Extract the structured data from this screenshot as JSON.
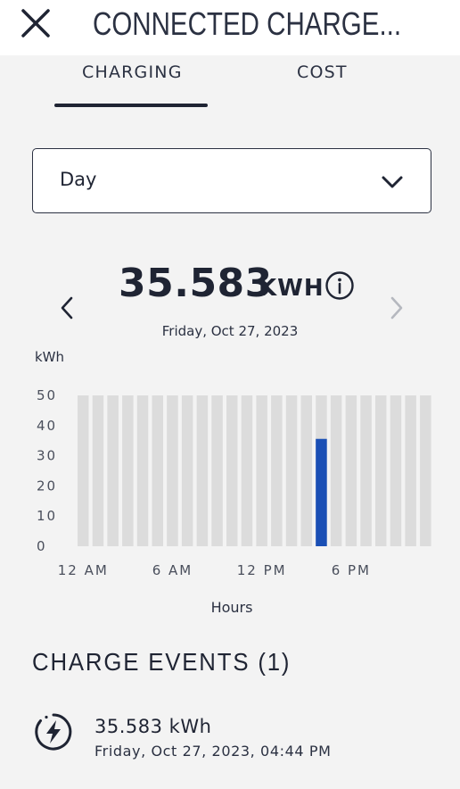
{
  "header": {
    "title": "CONNECTED CHARGE...",
    "close_icon": "close-icon"
  },
  "tabs": [
    {
      "label": "CHARGING",
      "selected": true
    },
    {
      "label": "COST",
      "selected": false
    }
  ],
  "period_select": {
    "value": "Day",
    "icon": "chevron-down-icon"
  },
  "summary": {
    "total_value": "35.583",
    "total_unit": "KWH",
    "info_icon": "info-icon",
    "date": "Friday, Oct 27, 2023",
    "prev_icon": "chevron-left-icon",
    "next_icon": "chevron-right-icon",
    "next_enabled": false
  },
  "colors": {
    "accent": "#1a4fb5",
    "bar_background": "#dcdcdc",
    "text": "#1f2433"
  },
  "chart_data": {
    "type": "bar",
    "ylabel": "kWh",
    "xlabel": "Hours",
    "ylim": [
      0,
      50
    ],
    "yticks": [
      50,
      40,
      30,
      20,
      10,
      0
    ],
    "xtick_labels": [
      {
        "label": "12 AM",
        "hour": 0
      },
      {
        "label": "6 AM",
        "hour": 6
      },
      {
        "label": "12 PM",
        "hour": 12
      },
      {
        "label": "6 PM",
        "hour": 18
      }
    ],
    "categories": [
      0,
      1,
      2,
      3,
      4,
      5,
      6,
      7,
      8,
      9,
      10,
      11,
      12,
      13,
      14,
      15,
      16,
      17,
      18,
      19,
      20,
      21,
      22,
      23
    ],
    "values": [
      0,
      0,
      0,
      0,
      0,
      0,
      0,
      0,
      0,
      0,
      0,
      0,
      0,
      0,
      0,
      0,
      35.583,
      0,
      0,
      0,
      0,
      0,
      0,
      0
    ],
    "grid": false
  },
  "events": {
    "title": "CHARGE EVENTS (1)",
    "items": [
      {
        "icon": "charging-bolt-icon",
        "value": "35.583 kWh",
        "datetime": "Friday, Oct 27, 2023, 04:44 PM"
      }
    ]
  }
}
